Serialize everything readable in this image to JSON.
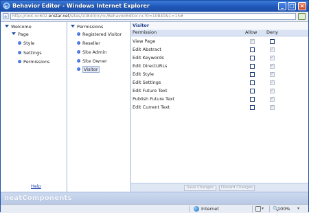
{
  "window": {
    "title": "Behavior Editor - Windows Internet Explorer",
    "url_prefix": "http://root.nc602.",
    "url_domain": "enstar.net",
    "url_suffix": "/sites/10840/rc/nc/BehaviorEditor.nc?0=10840&1=15#"
  },
  "tree": {
    "root": "Welcome",
    "page": "Page",
    "children": [
      "Style",
      "Settings",
      "Permissions"
    ],
    "help": "Help"
  },
  "roles": {
    "root": "Permissions",
    "items": [
      "Registered Visitor",
      "Reseller",
      "Site Admin",
      "Site Owner",
      "Visitor"
    ]
  },
  "permissions": {
    "header": "Visitor",
    "col_permission": "Permission",
    "col_allow": "Allow",
    "col_deny": "Deny",
    "rows": [
      "View Page",
      "Edit Abstract",
      "Edit Keywords",
      "Edit DirectURLs",
      "Edit Style",
      "Edit Settings",
      "Edit Future Text",
      "Publish Future Text",
      "Edit Current Text"
    ],
    "save_label": "Save Changes",
    "discard_label": "Discard Changes"
  },
  "brand": "neatComponents",
  "status": {
    "zone": "Internet",
    "zoom": "100%"
  },
  "colors": {
    "titlebar": "#1f56b8",
    "accent": "#1e3e8a"
  }
}
